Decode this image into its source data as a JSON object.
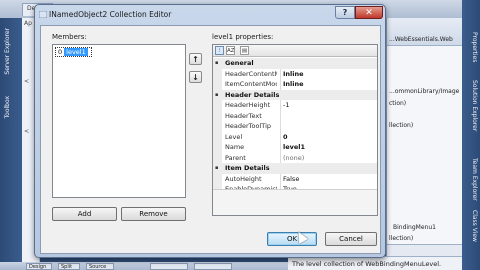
{
  "ide": {
    "top_tabs": [
      "Design",
      "",
      ""
    ],
    "left_tabs": [
      "Server Explorer",
      "Toolbox"
    ],
    "editor_fragments": [
      "Ap",
      "<",
      "<"
    ],
    "right_panel": {
      "line1": "...WebEssentials.Web",
      "line2": "...ommonLibrary/Image",
      "line3": "ction)",
      "line4": "llection)",
      "line5": "BindingMenu1",
      "line6": "llection)"
    },
    "right_tabs": [
      "Properties",
      "Solution Explorer",
      "Team Explorer",
      "Class View"
    ],
    "description": "The level collection of WebBindingMenuLevel.",
    "taskbar": [
      "Design",
      "Split",
      "Source",
      "",
      ""
    ]
  },
  "dialog": {
    "title": "INamedObject2 Collection Editor",
    "help_label": "?",
    "close_label": "✕",
    "members_label": "Members:",
    "members": [
      {
        "index": "0",
        "name": "level1"
      }
    ],
    "properties_label": "level1 properties:",
    "move_up": "↑",
    "move_down": "↓",
    "add_label": "Add",
    "remove_label": "Remove",
    "ok_label": "OK",
    "cancel_label": "Cancel",
    "toolbar": {
      "categorized": "⁝",
      "alpha": "AZ",
      "pages": "▤"
    },
    "property_groups": [
      {
        "name": "General",
        "rows": [
          {
            "name": "HeaderContentMo",
            "value": "Inline",
            "bold": true
          },
          {
            "name": "ItemContentMode",
            "value": "Inline",
            "bold": true
          }
        ]
      },
      {
        "name": "Header Details",
        "rows": [
          {
            "name": "HeaderHeight",
            "value": "-1",
            "bold": false
          },
          {
            "name": "HeaderText",
            "value": "",
            "bold": false
          },
          {
            "name": "HeaderToolTip",
            "value": "",
            "bold": false
          },
          {
            "name": "Level",
            "value": "0",
            "bold": true
          },
          {
            "name": "Name",
            "value": "level1",
            "bold": true
          },
          {
            "name": "Parent",
            "value": "(none)",
            "bold": false,
            "grey": true
          }
        ]
      },
      {
        "name": "Item Details",
        "rows": [
          {
            "name": "AutoHeight",
            "value": "False",
            "bold": false
          },
          {
            "name": "EnableDynamicSty",
            "value": "True",
            "bold": false
          }
        ]
      }
    ]
  },
  "colors": {
    "selection": "#3399ff",
    "dialog_frame": "#c8d7ea",
    "ide_blue": "#2f4d78"
  }
}
